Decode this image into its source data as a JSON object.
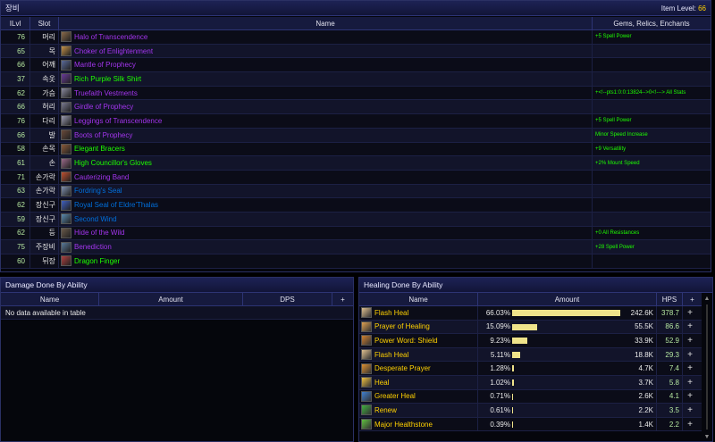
{
  "gear": {
    "title": "장비",
    "item_level_label": "Item Level:",
    "item_level_value": "66",
    "columns": [
      "ILvl",
      "Slot",
      "Name",
      "Gems, Relics, Enchants"
    ],
    "items": [
      {
        "ilvl": "76",
        "slot": "머리",
        "name": "Halo of Transcendence",
        "enchant": "+5 Spell Power",
        "color": "#a335ee",
        "icon": "#8a6a4a"
      },
      {
        "ilvl": "65",
        "slot": "목",
        "name": "Choker of Enlightenment",
        "enchant": "",
        "color": "#a335ee",
        "icon": "#c4914a"
      },
      {
        "ilvl": "66",
        "slot": "어깨",
        "name": "Mantle of Prophecy",
        "enchant": "",
        "color": "#a335ee",
        "icon": "#5a6a9a"
      },
      {
        "ilvl": "37",
        "slot": "속옷",
        "name": "Rich Purple Silk Shirt",
        "enchant": "",
        "color": "#1eff00",
        "icon": "#6a3a9a"
      },
      {
        "ilvl": "62",
        "slot": "가슴",
        "name": "Truefaith Vestments",
        "enchant": "+<!--pts1:0:0:13824-->0<!---> All Stats",
        "color": "#a335ee",
        "icon": "#8a8aa0"
      },
      {
        "ilvl": "66",
        "slot": "허리",
        "name": "Girdle of Prophecy",
        "enchant": "",
        "color": "#a335ee",
        "icon": "#7a7a90"
      },
      {
        "ilvl": "76",
        "slot": "다리",
        "name": "Leggings of Transcendence",
        "enchant": "+5 Spell Power",
        "color": "#a335ee",
        "icon": "#9a9ab0"
      },
      {
        "ilvl": "66",
        "slot": "발",
        "name": "Boots of Prophecy",
        "enchant": "Minor Speed Increase",
        "color": "#a335ee",
        "icon": "#6a4a3a"
      },
      {
        "ilvl": "58",
        "slot": "손목",
        "name": "Elegant Bracers",
        "enchant": "+9 Versatility",
        "color": "#1eff00",
        "icon": "#8a5a3a"
      },
      {
        "ilvl": "61",
        "slot": "손",
        "name": "High Councillor's Gloves",
        "enchant": "+2% Mount Speed",
        "color": "#1eff00",
        "icon": "#9a6a8a"
      },
      {
        "ilvl": "71",
        "slot": "손가락",
        "name": "Cauterizing Band",
        "enchant": "",
        "color": "#a335ee",
        "icon": "#c05030"
      },
      {
        "ilvl": "63",
        "slot": "손가락",
        "name": "Fordring's Seal",
        "enchant": "",
        "color": "#0070dd",
        "icon": "#8090b0"
      },
      {
        "ilvl": "62",
        "slot": "장신구",
        "name": "Royal Seal of Eldre'Thalas",
        "enchant": "",
        "color": "#0070dd",
        "icon": "#4060c0"
      },
      {
        "ilvl": "59",
        "slot": "장신구",
        "name": "Second Wind",
        "enchant": "",
        "color": "#0070dd",
        "icon": "#5a8ab0"
      },
      {
        "ilvl": "62",
        "slot": "등",
        "name": "Hide of the Wild",
        "enchant": "+0 All Resistances",
        "color": "#a335ee",
        "icon": "#6a5a4a"
      },
      {
        "ilvl": "75",
        "slot": "주장비",
        "name": "Benediction",
        "enchant": "+28 Spell Power",
        "color": "#a335ee",
        "icon": "#5a7a9a"
      },
      {
        "ilvl": "60",
        "slot": "뒤장",
        "name": "Dragon Finger",
        "enchant": "",
        "color": "#1eff00",
        "icon": "#b04040"
      }
    ]
  },
  "damage": {
    "title": "Damage Done By Ability",
    "columns": [
      "Name",
      "Amount",
      "DPS",
      "+"
    ],
    "empty_text": "No data available in table"
  },
  "healing": {
    "title": "Healing Done By Ability",
    "columns": [
      "Name",
      "Amount",
      "HPS",
      "+"
    ],
    "rows": [
      {
        "name": "Flash Heal",
        "pct": "66.03%",
        "fraction": 0.6603,
        "amount": "242.6K",
        "hps": "378.7",
        "icon": "#e0c090"
      },
      {
        "name": "Prayer of Healing",
        "pct": "15.09%",
        "fraction": 0.1509,
        "amount": "55.5K",
        "hps": "86.6",
        "icon": "#e0a050"
      },
      {
        "name": "Power Word: Shield",
        "pct": "9.23%",
        "fraction": 0.0923,
        "amount": "33.9K",
        "hps": "52.9",
        "icon": "#d08030"
      },
      {
        "name": "Flash Heal",
        "pct": "5.11%",
        "fraction": 0.0511,
        "amount": "18.8K",
        "hps": "29.3",
        "icon": "#e0c090"
      },
      {
        "name": "Desperate Prayer",
        "pct": "1.28%",
        "fraction": 0.0128,
        "amount": "4.7K",
        "hps": "7.4",
        "icon": "#e09030"
      },
      {
        "name": "Heal",
        "pct": "1.02%",
        "fraction": 0.0102,
        "amount": "3.7K",
        "hps": "5.8",
        "icon": "#f0c040"
      },
      {
        "name": "Greater Heal",
        "pct": "0.71%",
        "fraction": 0.0071,
        "amount": "2.6K",
        "hps": "4.1",
        "icon": "#4080d0"
      },
      {
        "name": "Renew",
        "pct": "0.61%",
        "fraction": 0.0061,
        "amount": "2.2K",
        "hps": "3.5",
        "icon": "#40b040"
      },
      {
        "name": "Major Healthstone",
        "pct": "0.39%",
        "fraction": 0.0039,
        "amount": "1.4K",
        "hps": "2.2",
        "icon": "#60c040"
      }
    ],
    "add_label": "+"
  }
}
